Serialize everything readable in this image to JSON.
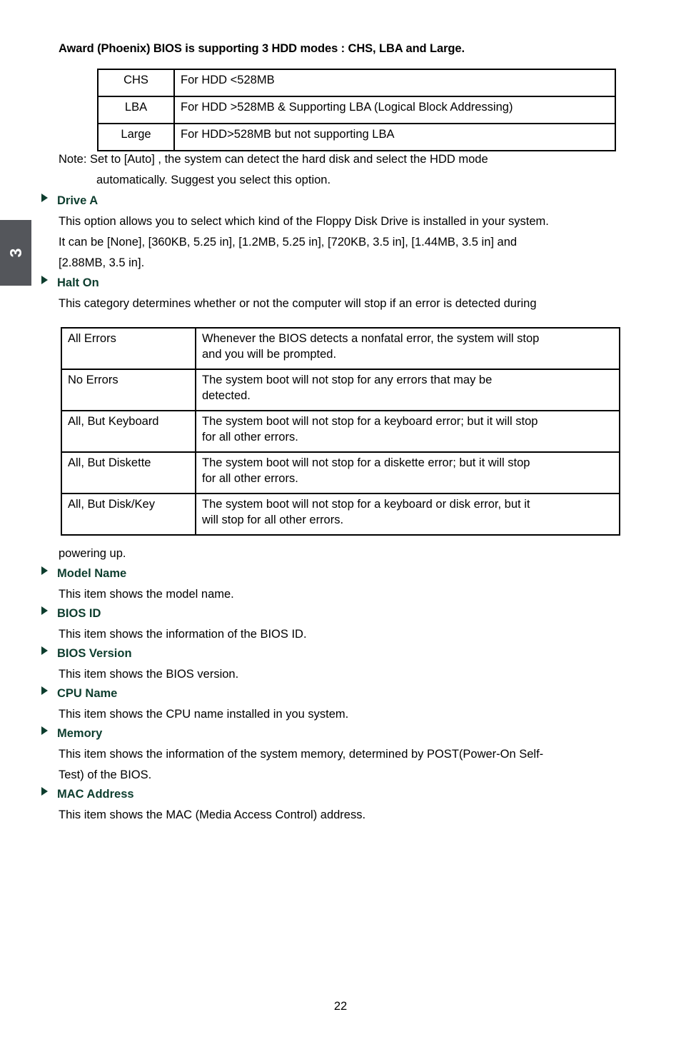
{
  "page": {
    "number": "22",
    "chapter_tab": "3",
    "accent_heading_color": "#0d3d2e",
    "tab_color": "#54565b"
  },
  "title": "Award (Phoenix) BIOS is supporting 3 HDD modes : CHS, LBA and Large.",
  "hdd_modes_table": {
    "rows": [
      {
        "mode": "CHS",
        "description": "For HDD <528MB"
      },
      {
        "mode": "LBA",
        "description": "For HDD >528MB & Supporting LBA (Logical Block Addressing)"
      },
      {
        "mode": "Large",
        "description": "For HDD>528MB but not supporting LBA"
      }
    ]
  },
  "note": {
    "line1": "Note: Set to [Auto] , the system can detect the hard disk and select the HDD mode",
    "line2": "automatically. Suggest you select this option."
  },
  "sections": {
    "drive_a": {
      "heading": "Drive A",
      "body_line1": "This option allows you to select which kind of the Floppy Disk Drive is installed in your system.",
      "body_line2": "It can be [None], [360KB, 5.25 in], [1.2MB, 5.25 in], [720KB, 3.5 in], [1.44MB, 3.5 in] and",
      "body_line3": "[2.88MB, 3.5 in]."
    },
    "halt_on": {
      "heading": "Halt On",
      "body_line1": "This category determines whether or not the computer will stop if an error is detected during",
      "body_line2": "powering up."
    },
    "model_name": {
      "heading": "Model Name",
      "body_line1": "This item shows the model name."
    },
    "bios_id": {
      "heading": "BIOS ID",
      "body_line1": "This item shows the information of the BIOS ID."
    },
    "bios_version": {
      "heading": "BIOS Version",
      "body_line1": "This item shows the BIOS version."
    },
    "cpu_name": {
      "heading": "CPU Name",
      "body_line1": "This item shows the CPU name installed in you system."
    },
    "memory": {
      "heading": "Memory",
      "body_line1": "This item shows the information of the system memory, determined by POST(Power-On Self-",
      "body_line2": "Test) of the BIOS."
    },
    "mac_address": {
      "heading": "MAC Address",
      "body_line1": "This item shows the MAC (Media Access Control) address."
    }
  },
  "halt_on_table": {
    "rows": [
      {
        "option": "All Errors",
        "description_line1": "Whenever the BIOS detects a nonfatal error, the system will stop",
        "description_line2": "and you will be prompted."
      },
      {
        "option": "No Errors",
        "description_line1": "The system boot will not stop for any errors that may be",
        "description_line2": "detected."
      },
      {
        "option": "All, But Keyboard",
        "description_line1": "The system boot will not stop for a keyboard error; but it will stop",
        "description_line2": "for all other errors."
      },
      {
        "option": "All, But Diskette",
        "description_line1": "The system boot will not stop for a diskette error; but it will stop",
        "description_line2": "for all other errors."
      },
      {
        "option": "All, But Disk/Key",
        "description_line1": "The system boot will not stop for a keyboard or disk error, but it",
        "description_line2": "will stop for all other errors."
      }
    ]
  }
}
